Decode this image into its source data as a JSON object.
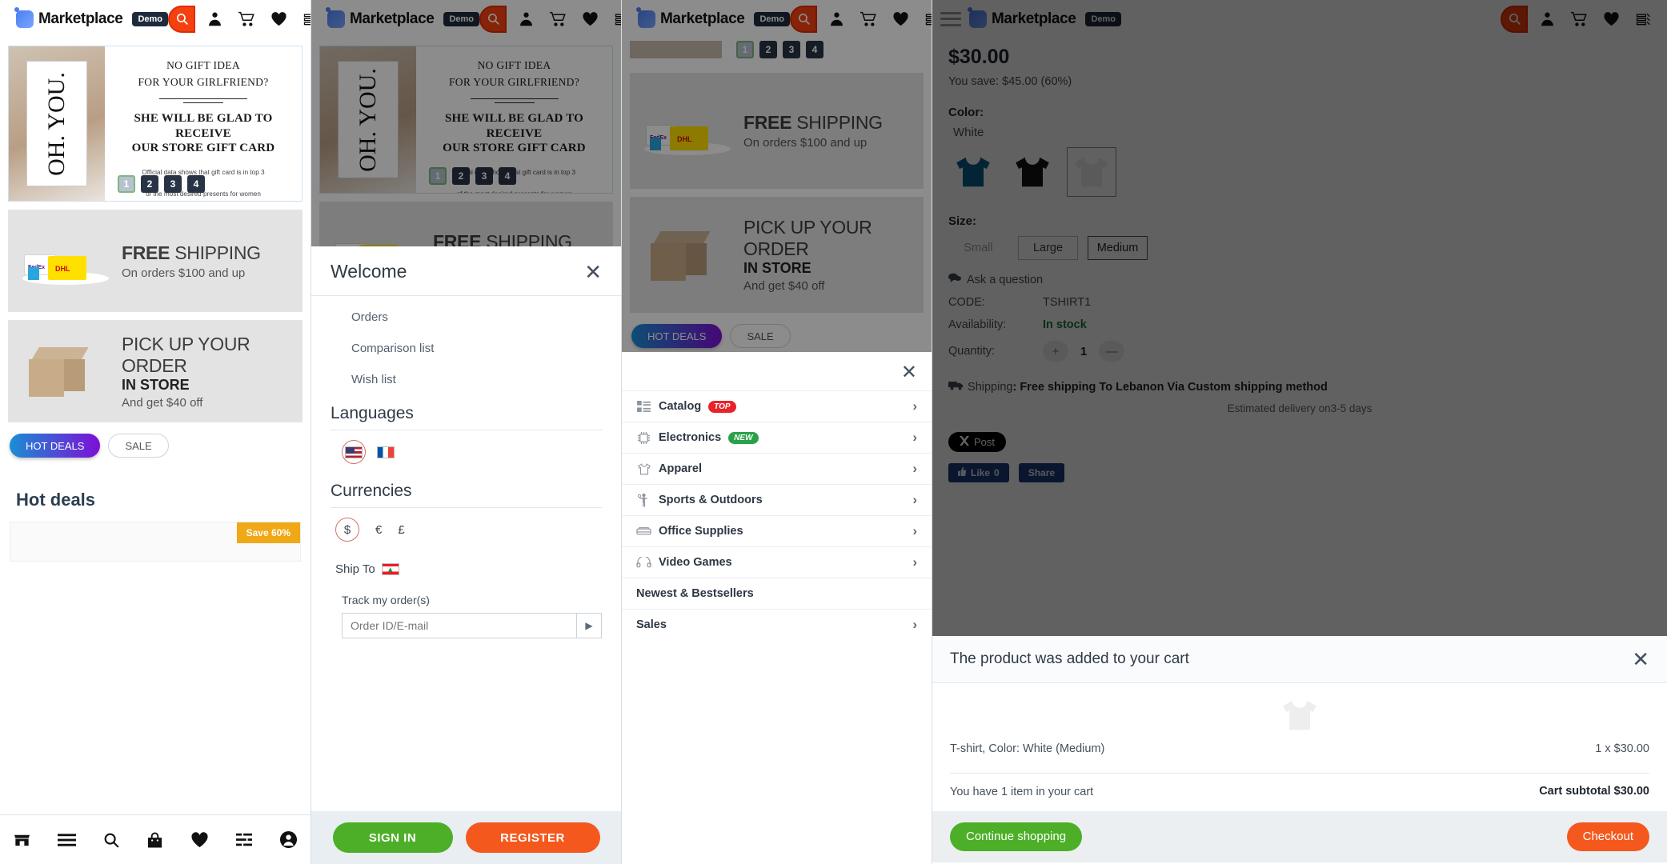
{
  "header": {
    "logo_text": "Marketplace",
    "demo_badge": "Demo",
    "icons": [
      "menu-icon",
      "logo-icon",
      "search-icon",
      "account-icon",
      "cart-icon",
      "heart-icon",
      "compare-icon"
    ]
  },
  "banner": {
    "card_text": "OH. YOU.",
    "line1": "NO GIFT IDEA",
    "line2": "FOR YOUR GIRLFRIEND?",
    "headline1": "SHE WILL BE GLAD TO RECEIVE",
    "headline2": "OUR STORE GIFT CARD",
    "fineprint1": "Official data shows that gift card is in top 3",
    "fineprint2": "of the most desired presents for women",
    "dots": [
      "1",
      "2",
      "3",
      "4"
    ],
    "active_dot": "1"
  },
  "promo_shipping": {
    "big_bold": "FREE",
    "big_rest": " SHIPPING",
    "sub": "On orders $100 and up"
  },
  "promo_pickup": {
    "line1": "PICK UP YOUR ORDER",
    "line2": "IN STORE",
    "line3": "And get $40 off"
  },
  "pills": {
    "hot": "HOT DEALS",
    "sale": "SALE"
  },
  "section": {
    "hot_deals_title": "Hot deals",
    "save_badge": "Save 60%"
  },
  "bottom_nav": [
    "store-icon",
    "menu-icon",
    "search-icon",
    "bag-icon",
    "heart-icon",
    "compare-icon",
    "account-icon"
  ],
  "welcome": {
    "title": "Welcome",
    "close": "✕",
    "links": [
      "Orders",
      "Comparison list",
      "Wish list"
    ],
    "languages_title": "Languages",
    "languages": [
      "English (US flag)",
      "French (FR flag)"
    ],
    "language_selected": "English (US flag)",
    "currencies_title": "Currencies",
    "currencies": [
      "$",
      "€",
      "£"
    ],
    "currency_selected": "$",
    "ship_to_label": "Ship To",
    "ship_to_country": "Lebanon",
    "track_label": "Track my order(s)",
    "track_placeholder": "Order ID/E-mail",
    "track_value": "",
    "track_go": "▶",
    "sign_in": "SIGN IN",
    "register": "REGISTER"
  },
  "catalog_menu": {
    "close": "✕",
    "items": [
      {
        "label": "Catalog",
        "icon": "grid-list-icon",
        "badge": "TOP",
        "badge_kind": "top",
        "chevron": "›"
      },
      {
        "label": "Electronics",
        "icon": "chip-icon",
        "badge": "NEW",
        "badge_kind": "new",
        "chevron": "›"
      },
      {
        "label": "Apparel",
        "icon": "tshirt-icon",
        "badge": "",
        "badge_kind": "",
        "chevron": "›"
      },
      {
        "label": "Sports & Outdoors",
        "icon": "person-icon",
        "badge": "",
        "badge_kind": "",
        "chevron": "›"
      },
      {
        "label": "Office Supplies",
        "icon": "sofa-icon",
        "badge": "",
        "badge_kind": "",
        "chevron": "›"
      },
      {
        "label": "Video Games",
        "icon": "headphones-icon",
        "badge": "",
        "badge_kind": "",
        "chevron": "›"
      },
      {
        "label": "Newest & Bestsellers",
        "icon": "",
        "badge": "",
        "badge_kind": "",
        "chevron": ""
      },
      {
        "label": "Sales",
        "icon": "",
        "badge": "",
        "badge_kind": "",
        "chevron": "›"
      }
    ]
  },
  "product": {
    "price": "$30.00",
    "you_save": "You save: $45.00 (60%)",
    "color_label": "Color:",
    "color_value": "White",
    "color_swatches": [
      "Blue",
      "Black",
      "White"
    ],
    "color_selected": "White",
    "size_label": "Size:",
    "sizes": [
      "Small",
      "Large",
      "Medium"
    ],
    "size_disabled": "Small",
    "size_selected": "Medium",
    "ask_question": "Ask a question",
    "code_label": "CODE:",
    "code_value": "TSHIRT1",
    "availability_label": "Availability:",
    "availability_value": "In stock",
    "quantity_label": "Quantity:",
    "quantity_value": "1",
    "qty_plus": "+",
    "qty_minus": "—",
    "shipping_label": "Shipping",
    "shipping_value": ": Free shipping To Lebanon Via Custom shipping method",
    "shipping_eta": "Estimated delivery on3-5 days",
    "x_post": "Post",
    "fb_like": "Like",
    "fb_like_count": "0",
    "fb_share": "Share"
  },
  "cart_popup": {
    "title": "The product was added to your cart",
    "close": "✕",
    "item_name": "T-shirt, Color: White (Medium)",
    "item_qty_price": "1 x $30.00",
    "summary": "You have 1 item in your cart",
    "subtotal": "Cart subtotal $30.00",
    "continue_label": "Continue shopping",
    "checkout_label": "Checkout"
  },
  "colors": {
    "accent_orange": "#f4410f",
    "green": "#4caf27",
    "red_badge": "#e8232a",
    "green_badge": "#2aa149",
    "in_stock": "#1f7a34",
    "dark_navy": "#283446"
  }
}
